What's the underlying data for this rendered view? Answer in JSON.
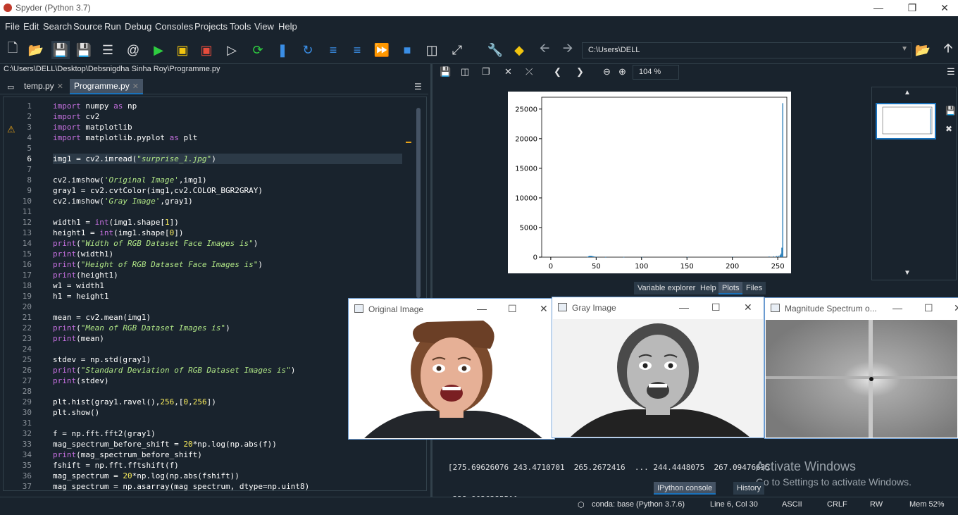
{
  "window": {
    "title": "Spyder (Python 3.7)",
    "controls": [
      "minimize",
      "restore",
      "close"
    ]
  },
  "menu": [
    "File",
    "Edit",
    "Search",
    "Source",
    "Run",
    "Debug",
    "Consoles",
    "Projects",
    "Tools",
    "View",
    "Help"
  ],
  "toolbar": {
    "path": "C:\\Users\\DELL",
    "icons": [
      "new-file-icon",
      "open-file-icon",
      "save-icon",
      "save-all-icon",
      "outline-icon",
      "at-icon",
      "run-icon",
      "run-cell-icon",
      "run-cell-advance-icon",
      "run-selection-icon",
      "rerun-icon",
      "debug-icon",
      "step-icon",
      "step-into-icon",
      "step-return-icon",
      "continue-icon",
      "stop-icon",
      "maximize-pane-icon",
      "fullscreen-icon",
      "preferences-icon",
      "python-path-icon",
      "back-arrow-icon",
      "forward-arrow-icon",
      "browse-folder-icon",
      "parent-dir-icon"
    ]
  },
  "editor": {
    "file_path": "C:\\Users\\DELL\\Desktop\\Debsnigdha Sinha Roy\\Programme.py",
    "tabs": [
      {
        "label": "temp.py",
        "active": false
      },
      {
        "label": "Programme.py",
        "active": true
      }
    ],
    "current_line": 6,
    "warning_line": 3,
    "lines": [
      "import numpy as np",
      "import cv2",
      "import matplotlib",
      "import matplotlib.pyplot as plt",
      "",
      "img1 = cv2.imread(\"surprise_1.jpg\")",
      "",
      "cv2.imshow('Original Image',img1)",
      "gray1 = cv2.cvtColor(img1,cv2.COLOR_BGR2GRAY)",
      "cv2.imshow('Gray Image',gray1)",
      "",
      "width1 = int(img1.shape[1])",
      "height1 = int(img1.shape[0])",
      "print(\"Width of RGB Dataset Face Images is\")",
      "print(width1)",
      "print(\"Height of RGB Dataset Face Images is\")",
      "print(height1)",
      "w1 = width1",
      "h1 = height1",
      "",
      "mean = cv2.mean(img1)",
      "print(\"Mean of RGB Dataset Images is\")",
      "print(mean)",
      "",
      "stdev = np.std(gray1)",
      "print(\"Standard Deviation of RGB Dataset Images is\")",
      "print(stdev)",
      "",
      "plt.hist(gray1.ravel(),256,[0,256])",
      "plt.show()",
      "",
      "f = np.fft.fft2(gray1)",
      "mag_spectrum_before_shift = 20*np.log(np.abs(f))",
      "print(mag_spectrum_before_shift)",
      "fshift = np.fft.fftshift(f)",
      "mag_spectrum = 20*np.log(np.abs(fshift))",
      "mag_spectrum = np.asarray(mag_spectrum, dtype=np.uint8)"
    ]
  },
  "plots": {
    "zoom": "104 %",
    "chart_data": {
      "type": "bar",
      "xlim": [
        -10,
        260
      ],
      "ylim": [
        0,
        27000
      ],
      "xticks": [
        0,
        50,
        100,
        150,
        200,
        250
      ],
      "yticks": [
        0,
        5000,
        10000,
        15000,
        20000,
        25000
      ],
      "x": [
        40,
        41,
        42,
        43,
        44,
        45,
        46,
        47,
        48,
        50,
        60,
        80,
        100,
        150,
        200,
        240,
        245,
        248,
        250,
        252,
        253,
        254,
        255
      ],
      "values": [
        60,
        160,
        220,
        240,
        230,
        200,
        160,
        120,
        90,
        40,
        20,
        30,
        30,
        60,
        80,
        120,
        140,
        200,
        250,
        320,
        600,
        1600,
        26000
      ]
    }
  },
  "pane_tabs": [
    {
      "label": "Variable explorer",
      "active": false
    },
    {
      "label": "Help",
      "active": false
    },
    {
      "label": "Plots",
      "active": true
    },
    {
      "label": "Files",
      "active": false
    }
  ],
  "console": {
    "output_line1": "[275.69626076 243.4710701  265.2672416  ... 244.4448075  267.09476635",
    "output_line2": " 238.90263855]]",
    "tabs": [
      {
        "label": "IPython console",
        "active": true
      },
      {
        "label": "History",
        "active": false
      }
    ]
  },
  "watermark": {
    "line1": "Activate Windows",
    "line2": "Go to Settings to activate Windows."
  },
  "cv_windows": [
    {
      "title": "Original Image"
    },
    {
      "title": "Gray Image"
    },
    {
      "title": "Magnitude Spectrum o..."
    }
  ],
  "statusbar": {
    "env": "conda: base (Python 3.7.6)",
    "position": "Line 6, Col 30",
    "encoding": "ASCII",
    "eol": "CRLF",
    "permissions": "RW",
    "memory": "Mem 52%"
  }
}
